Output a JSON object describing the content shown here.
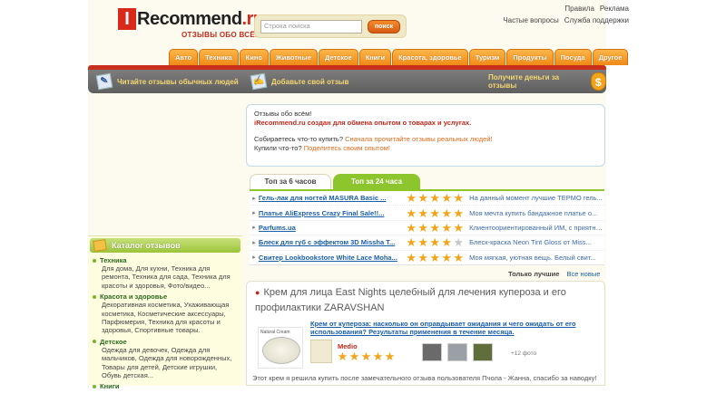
{
  "header": {
    "logo_i": "I",
    "logo_text": "Recommend",
    "logo_tld": ".ru",
    "tagline": "ОТЗЫВЫ ОБО ВСЁМ!",
    "search_placeholder": "Строка поиска",
    "search_button": "поиск",
    "links": {
      "rules": "Правила",
      "ads": "Реклама",
      "faq": "Частые вопросы",
      "support": "Служба поддержки"
    }
  },
  "nav": {
    "tabs": [
      "Авто",
      "Техника",
      "Кино",
      "Животные",
      "Детское",
      "Книги",
      "Красота, здоровье",
      "Туризм",
      "Продукты",
      "Посуда",
      "Другое"
    ]
  },
  "band": {
    "read_reviews": "Читайте отзывы обычных людей",
    "add_review": "Добавьте свой отзыв",
    "earn_money": "Получите деньги за отзывы",
    "money_symbol": "$"
  },
  "welcome": {
    "line1": "Отзывы обо всём!",
    "line2": "iRecommend.ru создан для обмена опытом о товарах и услугах.",
    "q1": "Собираетесь что-то купить?",
    "a1": "Сначала прочитайте отзывы реальных людей!",
    "q2": "Купили что-то?",
    "a2": "Поделитесь своим опытом!"
  },
  "top_tabs": {
    "tab6h": "Топ за 6 часов",
    "tab24h": "Топ за 24 часа"
  },
  "top_list": [
    {
      "name": "Гель-лак для ногтей MASURA Basic ...",
      "rating": 5,
      "desc": "На данный момент лучшие ТЕРМО гель..."
    },
    {
      "name": "Платье AliExpress Crazy Final Sale!!...",
      "rating": 5,
      "desc": "Моя мечта купить бандажное платье о..."
    },
    {
      "name": "Parfums.ua",
      "rating": 5,
      "desc": "Клиентоориентированный ИМ, с приятны..."
    },
    {
      "name": "Блеск для губ с эффектом 3D Missha T...",
      "rating": 4,
      "desc": "Блеск-краска Neon Tint Gloss от Miss..."
    },
    {
      "name": "Свитер Lookbookstore White Lace Moha...",
      "rating": 5,
      "desc": "Моя мягкая, уютная вещь. Белый свит..."
    }
  ],
  "sorts": {
    "best": "Только лучшие",
    "all": "Все новые"
  },
  "review": {
    "title": "Крем для лица East Nights целебный для лечения купероза и его профилактики ZARAVSHAN",
    "image_label": "Natural Cream",
    "headline": "Крем от купероза: насколько он оправдывает ожидания и чего ожидать от его использования? Результаты применения в течение месяца.",
    "author": "Medio",
    "rating": 5,
    "more_photos": "+12 фото",
    "text": "Этот крем я решила купить после замечательного отзыва пользователя Пчола - Жанна, спасибо за наводку!"
  },
  "catalog": {
    "title": "Каталог отзывов",
    "items": [
      {
        "name": "Техника",
        "sub": "Для дома, Для кухни, Техника для ремонта, Техника для сада, Техника для красоты и здоровья, Фото/видео..."
      },
      {
        "name": "Красота и здоровье",
        "sub": "Декоративная косметика, Ухаживающая косметика, Косметические аксессуары, Парфюмерия, Техника для красоты и здоровья, Спортивные товары."
      },
      {
        "name": "Детское",
        "sub": "Одежда для девочек, Одежда для мальчиков, Одежда для новорожденных, Товары для детей, Детские игрушки, Обувь детская..."
      },
      {
        "name": "Книги",
        "sub": ""
      }
    ]
  }
}
